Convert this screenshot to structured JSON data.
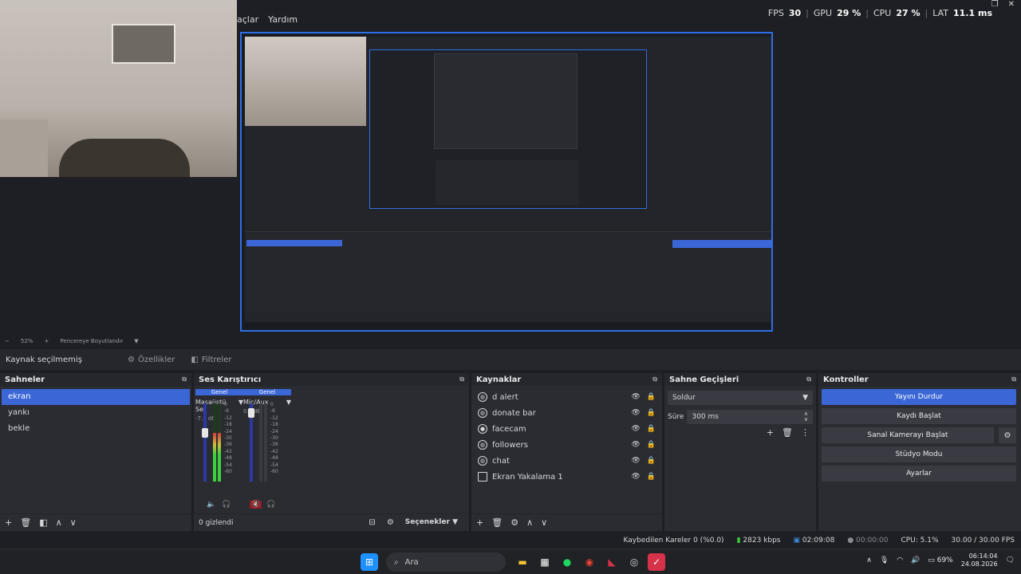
{
  "menu": [
    "açlar",
    "Yardım"
  ],
  "stats": {
    "fps_label": "FPS",
    "fps": "30",
    "gpu_label": "GPU",
    "gpu": "29 %",
    "cpu_label": "CPU",
    "cpu": "27 %",
    "lat_label": "LAT",
    "lat": "11.1 ms"
  },
  "zoombar": {
    "zoom": "52%",
    "fit_label": "Pencereye Boyutlandır"
  },
  "source_bar": {
    "no_source": "Kaynak seçilmemiş",
    "properties": "Özellikler",
    "filters": "Filtreler"
  },
  "scenes": {
    "title": "Sahneler",
    "items": [
      {
        "label": "ekran",
        "selected": true
      },
      {
        "label": "yankı"
      },
      {
        "label": "bekle"
      }
    ]
  },
  "mixer": {
    "title": "Ses Karıştırıcı",
    "channels": [
      {
        "header": "Genel",
        "name": "Masaüstü Ses",
        "db": "-7.9 dB",
        "level": 0.62
      },
      {
        "header": "Genel",
        "name": "Mic/Aux",
        "db": "0.0 dB",
        "level": 0.88
      }
    ],
    "ticks": [
      "0",
      "-6",
      "-12",
      "-18",
      "-24",
      "-30",
      "-36",
      "-42",
      "-48",
      "-54",
      "-60"
    ],
    "hidden": "0 gizlendi",
    "options": "Seçenekler"
  },
  "sources": {
    "title": "Kaynaklar",
    "items": [
      {
        "name": "d alert",
        "icon": "globe-icon"
      },
      {
        "name": "donate bar",
        "icon": "globe-icon"
      },
      {
        "name": "facecam",
        "icon": "camera-icon"
      },
      {
        "name": "followers",
        "icon": "globe-icon"
      },
      {
        "name": "chat",
        "icon": "globe-icon"
      },
      {
        "name": "Ekran Yakalama 1",
        "icon": "monitor-icon"
      }
    ]
  },
  "transitions": {
    "title": "Sahne Geçişleri",
    "selected": "Soldur",
    "duration_label": "Süre",
    "duration": "300 ms"
  },
  "controls": {
    "title": "Kontroller",
    "stop_stream": "Yayını Durdur",
    "start_record": "Kaydı Başlat",
    "virtual_cam": "Sanal Kamerayı Başlat",
    "studio_mode": "Stüdyo Modu",
    "settings": "Ayarlar"
  },
  "status": {
    "dropped": "Kaybedilen Kareler 0 (%0.0)",
    "bitrate": "2823 kbps",
    "stream_time": "02:09:08",
    "record_time": "00:00:00",
    "cpu": "CPU: 5.1%",
    "fps": "30.00 / 30.00 FPS"
  },
  "taskbar": {
    "search": "Ara",
    "battery": "69%",
    "time": "06:14:04",
    "date": "24.08.2026"
  }
}
